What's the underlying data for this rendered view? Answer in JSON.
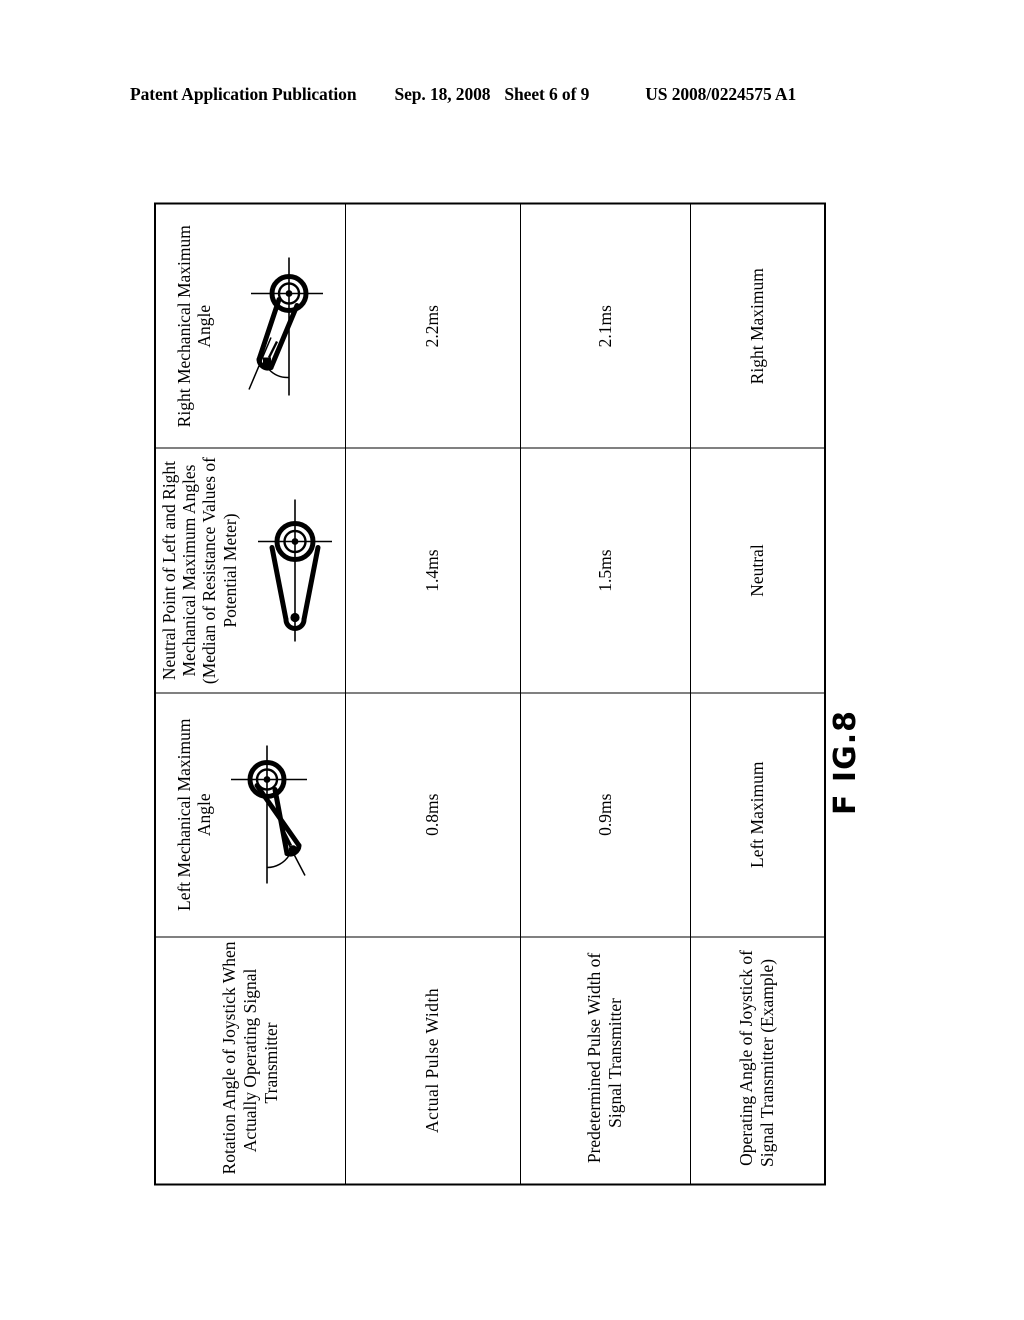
{
  "header": {
    "publication": "Patent Application Publication",
    "date": "Sep. 18, 2008",
    "sheet": "Sheet 6 of 9",
    "patent_number": "US 2008/0224575 A1"
  },
  "figure": {
    "caption": "F IG.8"
  },
  "table": {
    "columns": [
      {
        "id": "row-label",
        "header": "Operating Angle of Joystick of Signal Transmitter (Example)"
      },
      {
        "id": "predetermined",
        "header": "Predetermined Pulse Width of Signal Transmitter"
      },
      {
        "id": "actual",
        "header": "Actual  Pulse Width"
      },
      {
        "id": "rotation",
        "header": "Rotation Angle of Joystick When Actually Operating Signal Transmitter"
      }
    ],
    "rows": [
      {
        "label": "Left Maximum",
        "predetermined_pulse_width": "0.9ms",
        "actual_pulse_width": "0.8ms",
        "rotation_angle_label": "Left Mechanical Maximum Angle",
        "lever_icon": "joystick-lever-left-max-icon"
      },
      {
        "label": "Neutral",
        "predetermined_pulse_width": "1.5ms",
        "actual_pulse_width": "1.4ms",
        "rotation_angle_label": "Neutral Point of Left and Right Mechanical Maximum Angles (Median of Resistance Values of Potential Meter)",
        "lever_icon": "joystick-lever-neutral-icon"
      },
      {
        "label": "Right Maximum",
        "predetermined_pulse_width": "2.1ms",
        "actual_pulse_width": "2.2ms",
        "rotation_angle_label": "Right Mechanical Maximum Angle",
        "lever_icon": "joystick-lever-right-max-icon"
      }
    ]
  },
  "colors": {
    "ink": "#000000",
    "paper": "#ffffff"
  }
}
